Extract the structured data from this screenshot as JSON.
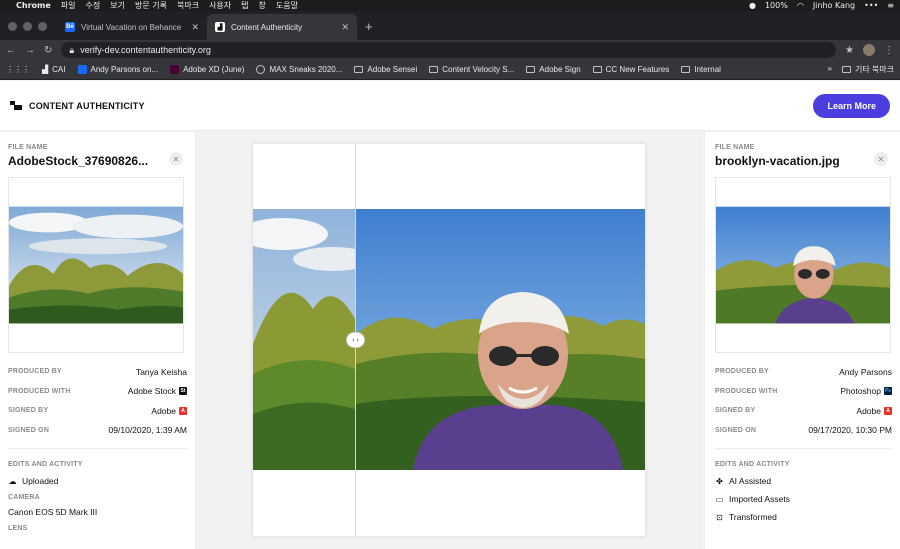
{
  "menubar": {
    "app": "Chrome",
    "items": [
      "파일",
      "수정",
      "보기",
      "방문 기록",
      "북마크",
      "사용자",
      "탭",
      "창",
      "도움말"
    ],
    "battery": "100%",
    "user": "Jinho Kang"
  },
  "tabs": [
    {
      "favicon": "Bē",
      "title": "Virtual Vacation on Behance"
    },
    {
      "favicon": "▟",
      "title": "Content Authenticity"
    }
  ],
  "address": {
    "url": "verify-dev.contentauthenticity.org"
  },
  "bookmarks": {
    "items": [
      "CAI",
      "Andy Parsons on...",
      "Adobe XD (June)",
      "MAX Sneaks 2020...",
      "Adobe Sensei",
      "Content Velocity S...",
      "Adobe Sign",
      "CC New Features",
      "Internal"
    ],
    "more": "»",
    "other": "기타 북마크"
  },
  "header": {
    "brand": "CONTENT AUTHENTICITY",
    "cta": "Learn More",
    "accent": "#4a3ee0"
  },
  "left_panel": {
    "file_label": "FILE NAME",
    "file_name": "AdobeStock_37690826...",
    "produced_by_label": "PRODUCED BY",
    "produced_by": "Tanya Keisha",
    "produced_with_label": "PRODUCED WITH",
    "produced_with": "Adobe Stock",
    "produced_with_badge": "St",
    "signed_by_label": "SIGNED BY",
    "signed_by": "Adobe",
    "signed_on_label": "SIGNED ON",
    "signed_on": "09/10/2020, 1:39 AM",
    "edits_label": "EDITS AND ACTIVITY",
    "edits": [
      "Uploaded"
    ],
    "camera_label": "CAMERA",
    "camera": "Canon EOS 5D Mark III",
    "lens_label": "LENS"
  },
  "right_panel": {
    "file_label": "FILE NAME",
    "file_name": "brooklyn-vacation.jpg",
    "produced_by_label": "PRODUCED BY",
    "produced_by": "Andy Parsons",
    "produced_with_label": "PRODUCED WITH",
    "produced_with": "Photoshop",
    "produced_with_badge": "Ps",
    "signed_by_label": "SIGNED BY",
    "signed_by": "Adobe",
    "signed_on_label": "SIGNED ON",
    "signed_on": "09/17/2020, 10:30 PM",
    "edits_label": "EDITS AND ACTIVITY",
    "edits": [
      "AI Assisted",
      "Imported Assets",
      "Transformed"
    ]
  },
  "compare": {
    "handle": "‹ ›"
  }
}
